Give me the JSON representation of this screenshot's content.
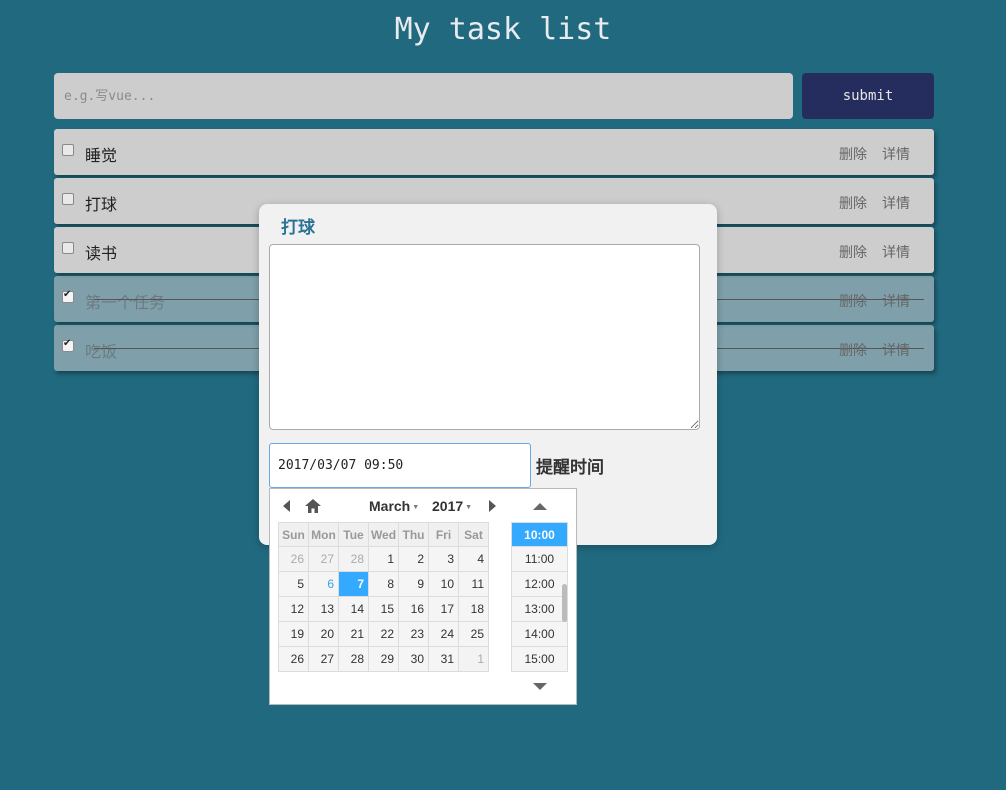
{
  "header": {
    "title": "My task list"
  },
  "new_task": {
    "placeholder": "e.g.写vue...",
    "submit_label": "submit"
  },
  "tasks": [
    {
      "name": "睡觉",
      "done": false,
      "delete_label": "删除",
      "detail_label": "详情"
    },
    {
      "name": "打球",
      "done": false,
      "delete_label": "删除",
      "detail_label": "详情"
    },
    {
      "name": "读书",
      "done": false,
      "delete_label": "删除",
      "detail_label": "详情"
    },
    {
      "name": "第一个任务",
      "done": true,
      "delete_label": "删除",
      "detail_label": "详情"
    },
    {
      "name": "吃饭",
      "done": true,
      "delete_label": "删除",
      "detail_label": "详情"
    }
  ],
  "modal": {
    "title": "打球",
    "description": "",
    "datetime_value": "2017/03/07 09:50",
    "remind_label": "提醒时间"
  },
  "picker": {
    "month": "March",
    "year": "2017",
    "weekdays": [
      "Sun",
      "Mon",
      "Tue",
      "Wed",
      "Thu",
      "Fri",
      "Sat"
    ],
    "weeks": [
      [
        "26",
        "27",
        "28",
        "1",
        "2",
        "3",
        "4"
      ],
      [
        "5",
        "6",
        "7",
        "8",
        "9",
        "10",
        "11"
      ],
      [
        "12",
        "13",
        "14",
        "15",
        "16",
        "17",
        "18"
      ],
      [
        "19",
        "20",
        "21",
        "22",
        "23",
        "24",
        "25"
      ],
      [
        "26",
        "27",
        "28",
        "29",
        "30",
        "31",
        "1"
      ]
    ],
    "selected_day": "7",
    "today_day": "6",
    "times": [
      "10:00",
      "11:00",
      "12:00",
      "13:00",
      "14:00",
      "15:00"
    ],
    "selected_time": "10:00"
  },
  "colors": {
    "background": "#21697f",
    "submit": "#252d5f",
    "accent": "#33aaff",
    "modal_title": "#2b7396"
  }
}
